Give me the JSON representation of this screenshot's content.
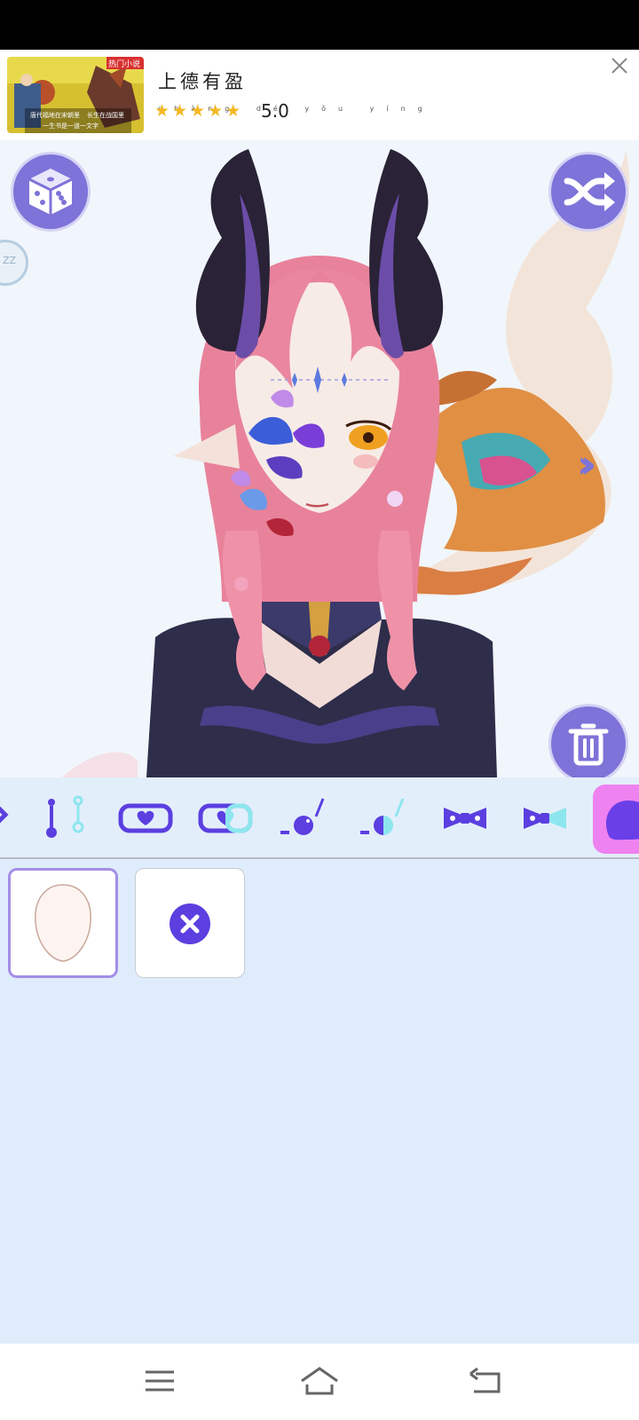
{
  "ad": {
    "title": "上德有盈",
    "pinyin": [
      "shàng",
      "dé",
      "yǒu",
      "yíng"
    ],
    "stars": "★★★★★",
    "rating": "5.0",
    "thumbnail_caption_top": "热门小说",
    "thumbnail_caption_lines": [
      "唐代福地在宋朝里",
      "长生在战国里",
      "一生书是一道一文字"
    ]
  },
  "canvas": {
    "side_tab_label": "ZZ",
    "icons": {
      "dice": "dice-icon",
      "shuffle": "shuffle-icon",
      "trash": "trash-icon",
      "next": "double-chevron-right-icon"
    }
  },
  "toolbar": {
    "items": [
      {
        "name": "bangs-tool",
        "icon": "partial-icon"
      },
      {
        "name": "piercing-tool",
        "icon": "piercing-icon"
      },
      {
        "name": "heart-blush-tool",
        "icon": "heart-icon"
      },
      {
        "name": "heart-blush-color-tool",
        "icon": "heart-color-icon"
      },
      {
        "name": "earring-tool",
        "icon": "earring-icon"
      },
      {
        "name": "earring-color-tool",
        "icon": "earring-color-icon"
      },
      {
        "name": "bow-tool",
        "icon": "bow-icon"
      },
      {
        "name": "bow-color-tool",
        "icon": "bow-color-icon"
      },
      {
        "name": "face-shape-tool",
        "icon": "blob-icon",
        "active": true
      }
    ]
  },
  "panel": {
    "items": [
      {
        "name": "face-shape-item",
        "selected": true
      },
      {
        "name": "none-item",
        "icon": "close-circle-icon"
      }
    ]
  },
  "colors": {
    "accent": "#7d73d8",
    "tool_purple": "#5b3fe0",
    "tool_cyan": "#8de6ee",
    "active_tab": "#ee82f0",
    "panel_bg": "#dfecfb",
    "canvas_bg": "#f0f6fc"
  },
  "nav": {
    "menu_icon": "menu-icon",
    "home_icon": "home-icon",
    "back_icon": "back-icon"
  }
}
